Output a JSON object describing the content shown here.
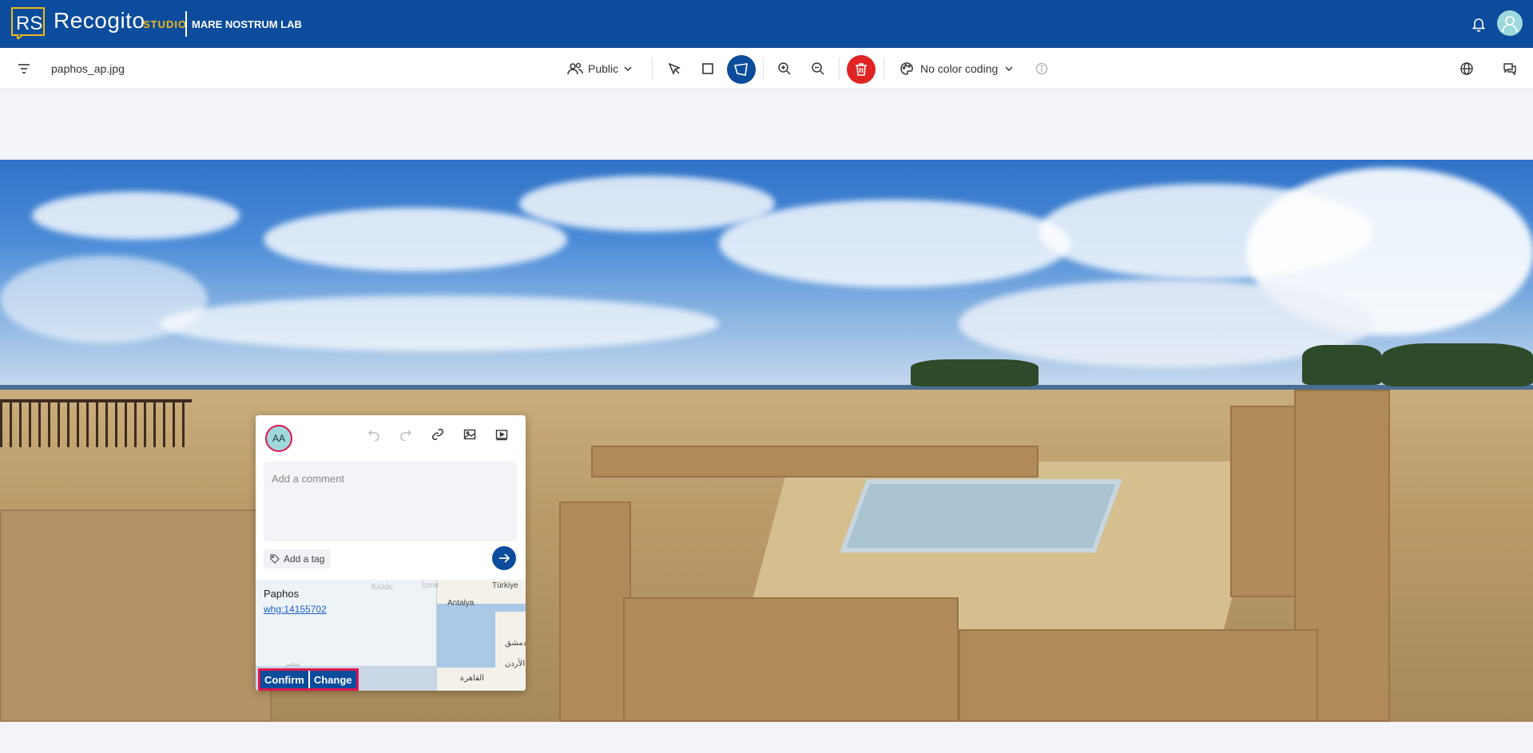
{
  "header": {
    "logo_text": "RS",
    "brand": "Recogito",
    "studio": "STUDIO",
    "project": "MARE NOSTRUM LAB",
    "icons": [
      "bell-icon",
      "user-avatar-icon"
    ]
  },
  "toolbar": {
    "filename": "paphos_ap.jpg",
    "visibility_label": "Public",
    "color_coding_label": "No color coding",
    "icons": [
      "filter-icon",
      "users-icon",
      "pointer-icon",
      "rectangle-icon",
      "polygon-icon",
      "zoom-in-icon",
      "zoom-out-icon",
      "trash-icon",
      "palette-icon",
      "info-icon",
      "globe-icon",
      "chat-icon"
    ]
  },
  "popup": {
    "avatar_initials": "AA",
    "comment_placeholder": "Add a comment",
    "tag_label": "Add a tag",
    "place": {
      "name": "Paphos",
      "link": "whg:14155702",
      "map_labels": {
        "turkey": "Türkiye",
        "antalya": "Antalya",
        "damascus": "دمشق",
        "cairo": "القاهرة",
        "jordan": "الأردن",
        "greece": "Ελλάς",
        "izmir": "İzmir",
        "egypt_faint": "مصر"
      }
    },
    "confirm_label": "Confirm",
    "change_label": "Change"
  },
  "colors": {
    "header_bg": "#0c4c9c",
    "accent_gold": "#f0b81a",
    "delete_red": "#e02424",
    "selection_outline": "#e0144c"
  }
}
